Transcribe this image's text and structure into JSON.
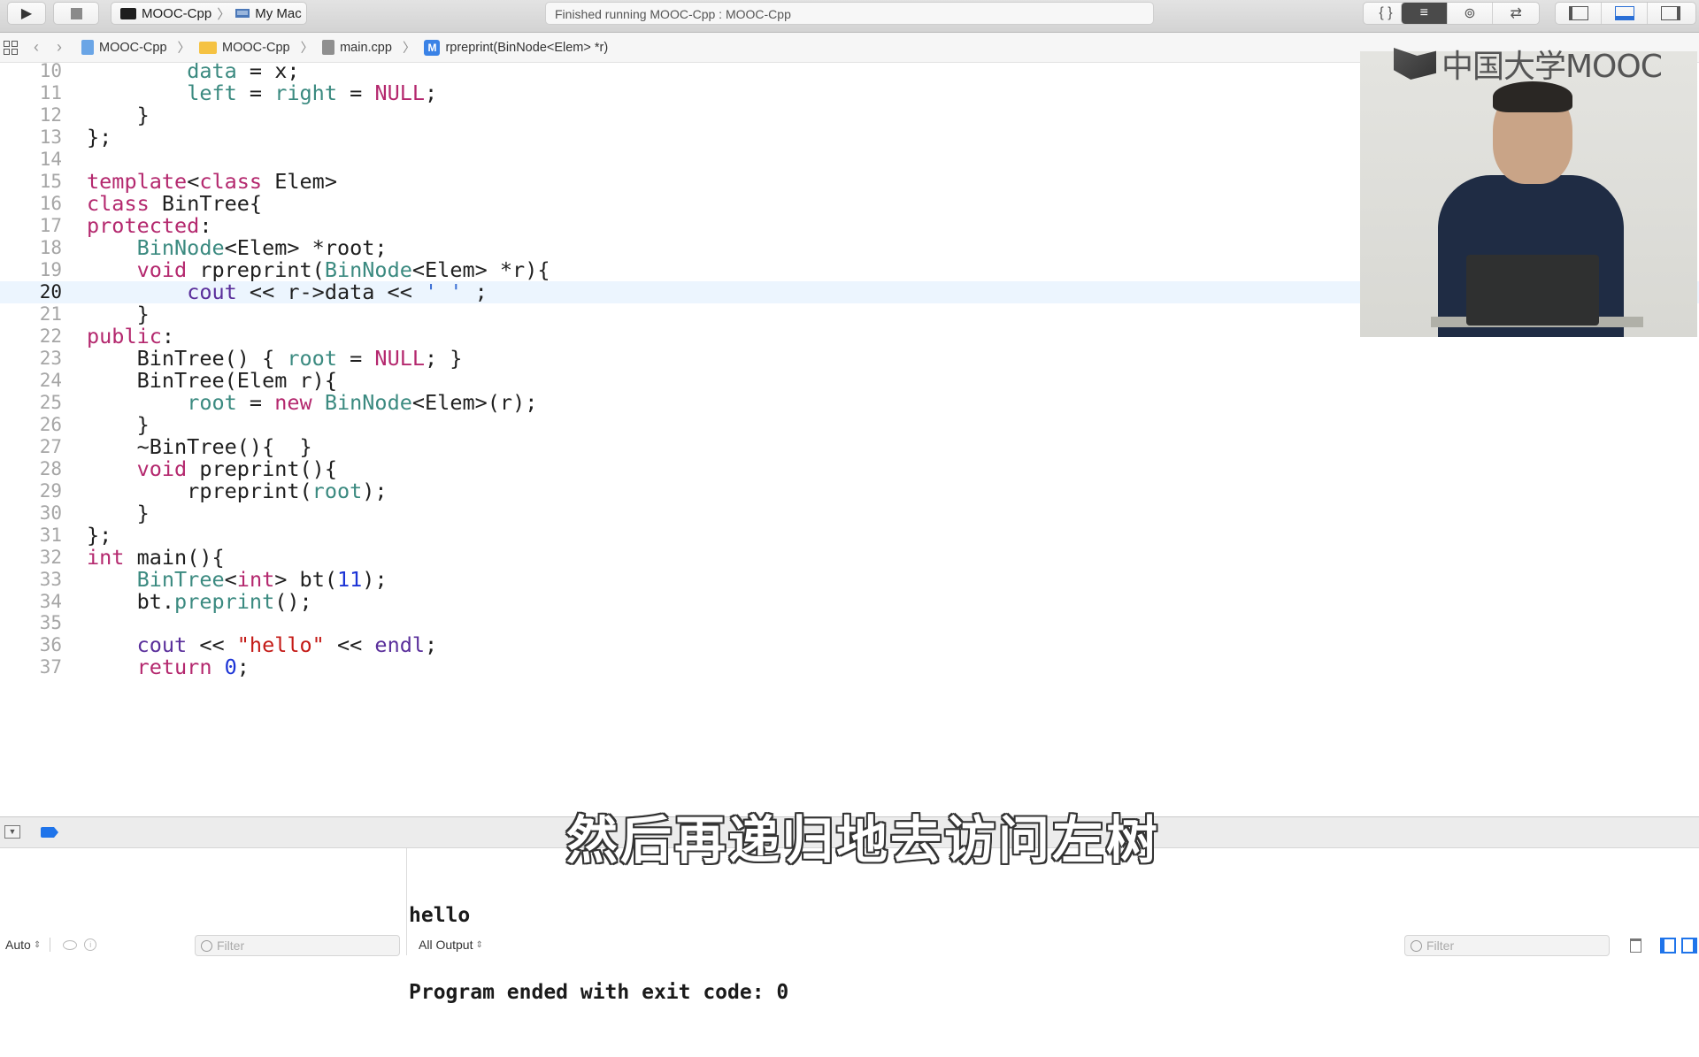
{
  "toolbar": {
    "run_icon": "play-icon",
    "stop_icon": "stop-icon",
    "scheme": "MOOC-Cpp",
    "destination": "My Mac",
    "status": "Finished running MOOC-Cpp : MOOC-Cpp",
    "editor_modes": [
      {
        "icon": "braces-icon",
        "glyph": "{ }"
      },
      {
        "icon": "standard-editor-icon",
        "glyph": "≡",
        "active": true
      },
      {
        "icon": "assistant-editor-icon",
        "glyph": "⊚"
      },
      {
        "icon": "version-editor-icon",
        "glyph": "⇄"
      }
    ],
    "panels": [
      {
        "icon": "navigator-panel-icon",
        "glyph": "▯"
      },
      {
        "icon": "debug-panel-icon",
        "glyph": "▭",
        "active": true
      },
      {
        "icon": "utilities-panel-icon",
        "glyph": "▯"
      }
    ]
  },
  "jumpbar": {
    "items": [
      {
        "label": "MOOC-Cpp",
        "icon": "project-icon"
      },
      {
        "label": "MOOC-Cpp",
        "icon": "folder-icon"
      },
      {
        "label": "main.cpp",
        "icon": "file-icon"
      },
      {
        "label": "rpreprint(BinNode<Elem> *r)",
        "icon": "method-icon",
        "badge": "M"
      }
    ]
  },
  "editor": {
    "current_line": 20,
    "lines": [
      {
        "n": "10",
        "tokens": [
          [
            "",
            "        "
          ],
          [
            "ty",
            "data"
          ],
          [
            "",
            " = x;"
          ]
        ]
      },
      {
        "n": "11",
        "tokens": [
          [
            "",
            "        "
          ],
          [
            "ty",
            "left"
          ],
          [
            "",
            " = "
          ],
          [
            "ty",
            "right"
          ],
          [
            "",
            " = "
          ],
          [
            "kw",
            "NULL"
          ],
          [
            "",
            ";"
          ]
        ]
      },
      {
        "n": "12",
        "tokens": [
          [
            "",
            "    }"
          ]
        ]
      },
      {
        "n": "13",
        "tokens": [
          [
            "",
            "};"
          ]
        ]
      },
      {
        "n": "14",
        "tokens": []
      },
      {
        "n": "15",
        "tokens": [
          [
            "kw",
            "template"
          ],
          [
            "",
            "<"
          ],
          [
            "kw",
            "class"
          ],
          [
            "",
            " Elem>"
          ]
        ]
      },
      {
        "n": "16",
        "tokens": [
          [
            "kw",
            "class"
          ],
          [
            "",
            " BinTree{"
          ]
        ]
      },
      {
        "n": "17",
        "tokens": [
          [
            "kw",
            "protected"
          ],
          [
            "",
            ":"
          ]
        ]
      },
      {
        "n": "18",
        "tokens": [
          [
            "",
            "    "
          ],
          [
            "ty",
            "BinNode"
          ],
          [
            "",
            "<Elem> *root;"
          ]
        ]
      },
      {
        "n": "19",
        "tokens": [
          [
            "",
            "    "
          ],
          [
            "kw",
            "void"
          ],
          [
            "",
            " rpreprint("
          ],
          [
            "ty",
            "BinNode"
          ],
          [
            "",
            "<Elem> *r){"
          ]
        ]
      },
      {
        "n": "20",
        "tokens": [
          [
            "",
            "        "
          ],
          [
            "lib",
            "cout"
          ],
          [
            "",
            " << r->data << "
          ],
          [
            "chr",
            "' '"
          ],
          [
            "",
            " ;"
          ]
        ]
      },
      {
        "n": "21",
        "tokens": [
          [
            "",
            "    }"
          ]
        ]
      },
      {
        "n": "22",
        "tokens": [
          [
            "kw",
            "public"
          ],
          [
            "",
            ":"
          ]
        ]
      },
      {
        "n": "23",
        "tokens": [
          [
            "",
            "    BinTree() { "
          ],
          [
            "ty",
            "root"
          ],
          [
            "",
            " = "
          ],
          [
            "kw",
            "NULL"
          ],
          [
            "",
            "; }"
          ]
        ]
      },
      {
        "n": "24",
        "tokens": [
          [
            "",
            "    BinTree(Elem r){"
          ]
        ]
      },
      {
        "n": "25",
        "tokens": [
          [
            "",
            "        "
          ],
          [
            "ty",
            "root"
          ],
          [
            "",
            " = "
          ],
          [
            "kw",
            "new"
          ],
          [
            "",
            " "
          ],
          [
            "ty",
            "BinNode"
          ],
          [
            "",
            "<Elem>(r);"
          ]
        ]
      },
      {
        "n": "26",
        "tokens": [
          [
            "",
            "    }"
          ]
        ]
      },
      {
        "n": "27",
        "tokens": [
          [
            "",
            "    ~BinTree(){  }"
          ]
        ]
      },
      {
        "n": "28",
        "tokens": [
          [
            "",
            "    "
          ],
          [
            "kw",
            "void"
          ],
          [
            "",
            " preprint(){"
          ]
        ]
      },
      {
        "n": "29",
        "tokens": [
          [
            "",
            "        rpreprint("
          ],
          [
            "ty",
            "root"
          ],
          [
            "",
            ");"
          ]
        ]
      },
      {
        "n": "30",
        "tokens": [
          [
            "",
            "    }"
          ]
        ]
      },
      {
        "n": "31",
        "tokens": [
          [
            "",
            "};"
          ]
        ]
      },
      {
        "n": "32",
        "tokens": [
          [
            "kw",
            "int"
          ],
          [
            "",
            " main(){"
          ]
        ]
      },
      {
        "n": "33",
        "tokens": [
          [
            "",
            "    "
          ],
          [
            "ty",
            "BinTree"
          ],
          [
            "",
            "<"
          ],
          [
            "kw",
            "int"
          ],
          [
            "",
            "> bt("
          ],
          [
            "num",
            "11"
          ],
          [
            "",
            ");"
          ]
        ]
      },
      {
        "n": "34",
        "tokens": [
          [
            "",
            "    bt."
          ],
          [
            "fn",
            "preprint"
          ],
          [
            "",
            "();"
          ]
        ]
      },
      {
        "n": "35",
        "tokens": []
      },
      {
        "n": "36",
        "tokens": [
          [
            "",
            "    "
          ],
          [
            "lib",
            "cout"
          ],
          [
            "",
            " << "
          ],
          [
            "str",
            "\"hello\""
          ],
          [
            "",
            " << "
          ],
          [
            "lib",
            "endl"
          ],
          [
            "",
            ";"
          ]
        ]
      },
      {
        "n": "37",
        "tokens": [
          [
            "",
            "    "
          ],
          [
            "kw",
            "return"
          ],
          [
            "",
            " "
          ],
          [
            "num",
            "0"
          ],
          [
            "",
            ";"
          ]
        ]
      }
    ]
  },
  "video_overlay": {
    "logo_text": "中国大学MOOC"
  },
  "debug": {
    "console_lines": [
      "hello",
      "Program ended with exit code: 0"
    ],
    "variables_scope": "Auto",
    "variables_filter_placeholder": "Filter",
    "output_selector": "All Output",
    "console_filter_placeholder": "Filter"
  },
  "subtitle": "然后再递归地去访问左树",
  "colors": {
    "keyword": "#b4286e",
    "type": "#3b8a80",
    "library": "#5a2f9b",
    "number": "#1c34d6",
    "string": "#c41a16",
    "current_line_bg": "#ecf5fe",
    "accent": "#1f74ea"
  }
}
